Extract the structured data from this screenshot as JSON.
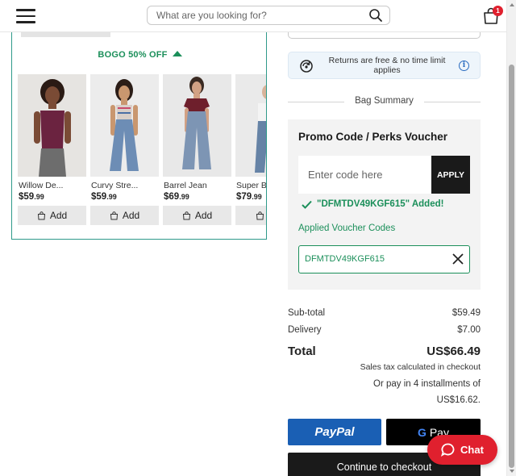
{
  "header": {
    "search_placeholder": "What are you looking for?",
    "bag_count": "1"
  },
  "promo_banner": {
    "label": "BOGO 50% OFF"
  },
  "products": [
    {
      "name": "Willow De...",
      "price_main": "$59",
      "price_cents": ".99",
      "add_label": "Add",
      "colors": {
        "bg": "#e6e4e1",
        "top": "#6b2340",
        "bottom": "#6d6d6d",
        "skin": "#7a4b35"
      }
    },
    {
      "name": "Curvy Stre...",
      "price_main": "$59",
      "price_cents": ".99",
      "add_label": "Add",
      "colors": {
        "bg": "#ececec",
        "top": "#d9cfc8",
        "bottom": "#6d8db5",
        "skin": "#c9976f"
      }
    },
    {
      "name": "Barrel Jean",
      "price_main": "$69",
      "price_cents": ".99",
      "add_label": "Add",
      "colors": {
        "bg": "#e8e8e8",
        "top": "#6e1f2c",
        "bottom": "#7d95b4",
        "skin": "#d2a184"
      }
    },
    {
      "name": "Super B",
      "price_main": "$79",
      "price_cents": ".99",
      "add_label": "",
      "colors": {
        "bg": "#eaeaea",
        "top": "#f4f4f4",
        "bottom": "#6683a6",
        "skin": "#d8b39a"
      }
    }
  ],
  "returns_notice": {
    "text": "Returns are free & no time limit applies"
  },
  "bag_summary": {
    "title": "Bag Summary"
  },
  "promo": {
    "title": "Promo Code / Perks Voucher",
    "input_placeholder": "Enter code here",
    "apply_label": "APPLY",
    "added_message": "\"DFMTDV49KGF615\" Added!",
    "applied_title": "Applied Voucher Codes",
    "applied_code": "DFMTDV49KGF615"
  },
  "totals": {
    "subtotal_label": "Sub-total",
    "subtotal_value": "$59.49",
    "delivery_label": "Delivery",
    "delivery_value": "$7.00",
    "total_label": "Total",
    "total_value": "US$66.49",
    "tax_note": "Sales tax calculated in checkout",
    "installments": "Or pay in 4 installments of US$16.62."
  },
  "payments": {
    "paypal_label": "PayPal",
    "gpay_g": "G",
    "gpay_label": " Pay",
    "checkout_label": "Continue to checkout"
  },
  "chat": {
    "label": "Chat"
  },
  "colors": {
    "brand_green": "#1b8f5a",
    "accent_red": "#e0202e",
    "paypal_blue": "#1a5fb4",
    "panel_border": "#2f9a8a"
  }
}
